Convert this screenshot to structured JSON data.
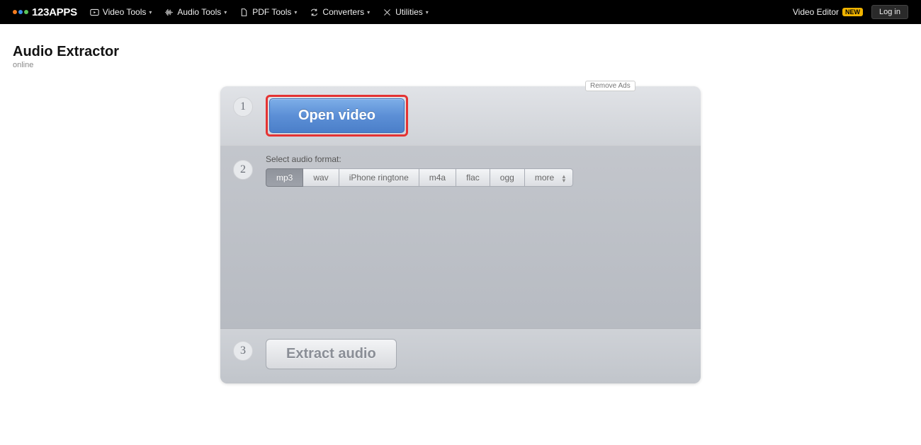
{
  "header": {
    "brand": "123APPS",
    "nav": [
      {
        "label": "Video Tools"
      },
      {
        "label": "Audio Tools"
      },
      {
        "label": "PDF Tools"
      },
      {
        "label": "Converters"
      },
      {
        "label": "Utilities"
      }
    ],
    "video_editor": "Video Editor",
    "badge": "NEW",
    "login": "Log in"
  },
  "page": {
    "title": "Audio Extractor",
    "subtitle": "online"
  },
  "remove_ads": "Remove Ads",
  "steps": {
    "one": {
      "num": "1",
      "open_video": "Open video"
    },
    "two": {
      "num": "2",
      "label": "Select audio format:",
      "formats": [
        "mp3",
        "wav",
        "iPhone ringtone",
        "m4a",
        "flac",
        "ogg",
        "more"
      ]
    },
    "three": {
      "num": "3",
      "extract": "Extract audio"
    }
  },
  "colors": {
    "dot1": "#f57c1f",
    "dot2": "#3b8ee8",
    "dot3": "#5ac65a"
  }
}
